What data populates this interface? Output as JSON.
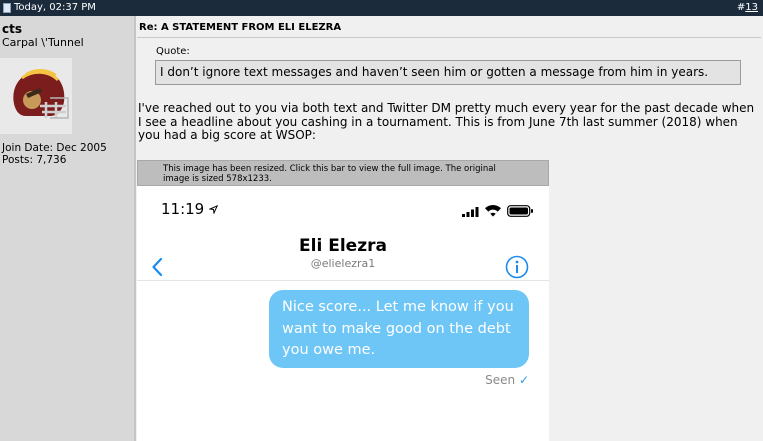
{
  "post": {
    "date": "Today, 02:37 PM",
    "number_prefix": "#",
    "number": "13",
    "title": "Re: A STATEMENT FROM ELI ELEZRA",
    "quote_label": "Quote:",
    "quote_text": "I don’t ignore text messages and haven’t seen him or gotten a message from him in years.",
    "body_lines": [
      "I've reached out to you via both text and Twitter DM pretty much every year for the past decade when",
      "I see a headline about you cashing in a tournament. This is from June 7th last summer (2018) when",
      "you had a big score at WSOP:"
    ]
  },
  "user": {
    "name": "cts",
    "title": "Carpal \\'Tunnel",
    "join_date": "Join Date: Dec 2005",
    "posts": "Posts: 7,736"
  },
  "resize_notice": {
    "line1": "This image has been resized. Click this bar to view the full image. The original",
    "line2": "image is sized 578x1233."
  },
  "screenshot": {
    "time": "11:19",
    "contact_name": "Eli Elezra",
    "contact_handle": "@elielezra1",
    "bubble_lines": [
      "Nice score... Let me know if you",
      "want to make good on the debt",
      "you owe me."
    ],
    "status": "Seen",
    "colors": {
      "bubble": "#6ec6f7",
      "accent": "#1a8cf0"
    }
  },
  "icons": [
    "document-icon",
    "warning-icon",
    "location-arrow-icon",
    "signal-bars-icon",
    "wifi-icon",
    "battery-icon",
    "back-chevron-icon",
    "info-icon",
    "checkmark-icon"
  ],
  "colors": {
    "header_bar": "#1c2b3c",
    "user_panel": "#d8d8d8",
    "message_panel": "#f0f0f0"
  }
}
